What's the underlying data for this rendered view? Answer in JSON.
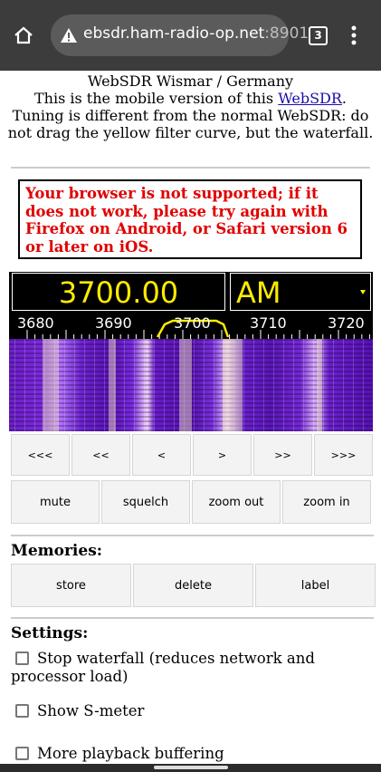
{
  "browser": {
    "url_host": "ebsdr.ham-radio-op.net",
    "url_port": ":8901",
    "tab_count": "3",
    "icons": [
      "home-icon",
      "warning-icon",
      "tabs-icon",
      "menu-icon"
    ]
  },
  "intro": {
    "line1": "WebSDR Wismar / Germany",
    "line2_prefix": "This is the mobile version of this ",
    "line2_link": "WebSDR",
    "line2_suffix": ".",
    "line3": "Tuning is different from the normal WebSDR: do not drag the yellow filter curve, but the waterfall."
  },
  "warning": "Your browser is not supported; if it does not work, please try again with Firefox on Android, or Safari version 6 or later on iOS.",
  "tuner": {
    "frequency": "3700.00",
    "mode": "AM",
    "scale_labels": [
      "3680",
      "3690",
      "3700",
      "3710",
      "3720"
    ]
  },
  "tuning_buttons": [
    "<<<",
    "<<",
    "<",
    ">",
    ">>",
    ">>>"
  ],
  "control_buttons": [
    "mute",
    "squelch",
    "zoom out",
    "zoom in"
  ],
  "memories": {
    "title": "Memories:",
    "buttons": [
      "store",
      "delete",
      "label"
    ]
  },
  "settings": {
    "title": "Settings:",
    "options": [
      {
        "label": "Stop waterfall (reduces network and processor load)",
        "checked": false
      },
      {
        "label": "Show S-meter",
        "checked": false
      },
      {
        "label": "More playback buffering",
        "checked": false
      }
    ]
  },
  "colors": {
    "chrome": "#3c3c3c",
    "display_text": "#ffeb00",
    "warning_text": "#e00000",
    "waterfall": "#6b1ec9"
  }
}
